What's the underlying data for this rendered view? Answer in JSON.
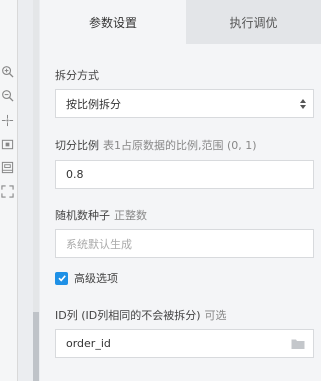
{
  "tabs": [
    {
      "label": "参数设置",
      "active": true
    },
    {
      "label": "执行调优",
      "active": false
    }
  ],
  "toolbar": {
    "icons": [
      "zoom-in-icon",
      "zoom-out-icon",
      "fit-view-icon",
      "minimap-icon",
      "layout-icon",
      "fullscreen-icon"
    ]
  },
  "split_method": {
    "label": "拆分方式",
    "value": "按比例拆分"
  },
  "split_ratio": {
    "label": "切分比例",
    "hint": "表1占原数据的比例,范围 (0, 1)",
    "value": "0.8"
  },
  "random_seed": {
    "label": "随机数种子",
    "hint": "正整数",
    "placeholder": "系统默认生成"
  },
  "advanced": {
    "label": "高级选项",
    "checked": true
  },
  "id_column": {
    "label": "ID列 (ID列相同的不会被拆分)",
    "hint": "可选",
    "value": "order_id"
  },
  "colors": {
    "accent": "#1e90e6",
    "panel_bg": "#f4f5f7",
    "inactive_tab_bg": "#e3e5e8"
  }
}
